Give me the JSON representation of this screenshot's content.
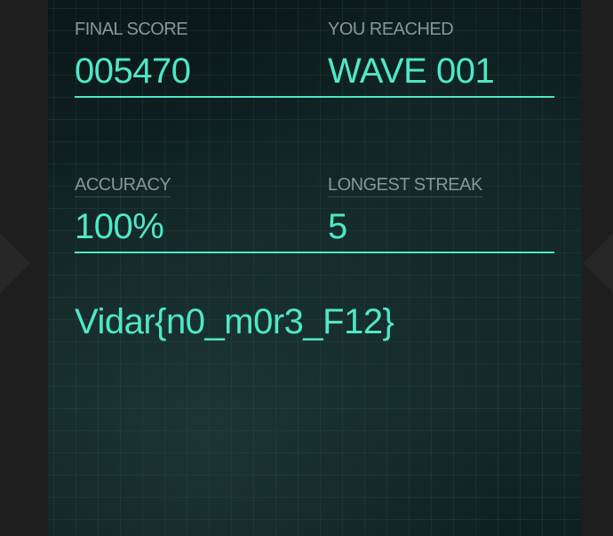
{
  "stats": {
    "final_score": {
      "label": "FINAL SCORE",
      "value": "005470"
    },
    "you_reached": {
      "label": "YOU REACHED",
      "value": "WAVE 001"
    },
    "accuracy": {
      "label": "ACCURACY",
      "value": "100%"
    },
    "longest_streak": {
      "label": "LONGEST STREAK",
      "value": "5"
    }
  },
  "flag_text": "Vidar{n0_m0r3_F12}",
  "colors": {
    "accent": "#4fe8c6",
    "label": "#8a9696",
    "panel_background": "#0d1c1d",
    "page_background": "#1e1e1e"
  }
}
